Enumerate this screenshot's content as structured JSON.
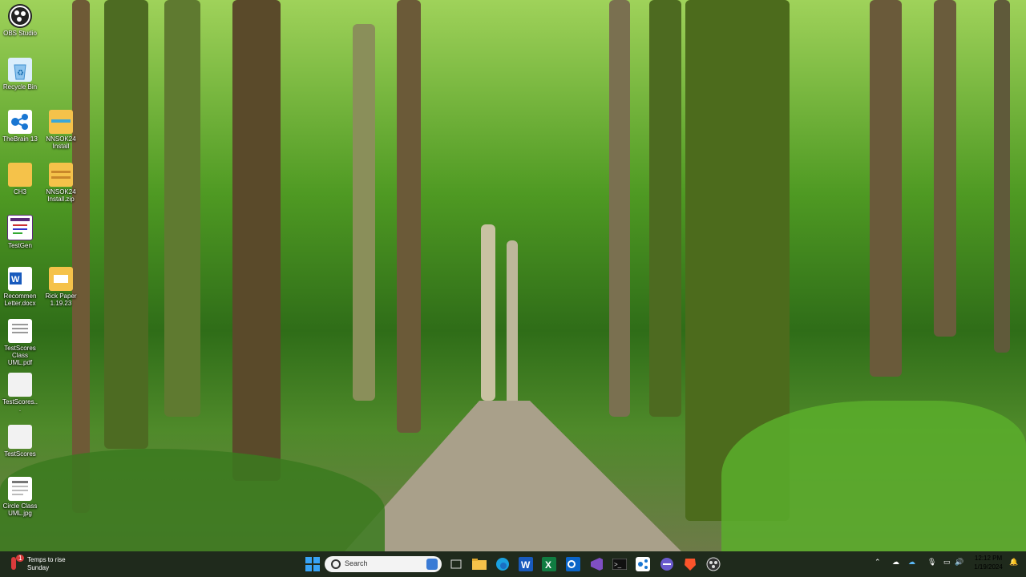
{
  "desktop_icons": [
    {
      "label": "OBS Studio"
    },
    {
      "label": "Recycle Bin"
    },
    {
      "label": "TheBrain 13"
    },
    {
      "label": "NNSOK24 Install"
    },
    {
      "label": "CH3"
    },
    {
      "label": "NNSOK24 Install.zip"
    },
    {
      "label": "TestGen"
    },
    {
      "label": "Recommen Letter.docx"
    },
    {
      "label": "Rick Paper 1.19.23"
    },
    {
      "label": "TestScores Class UML.pdf"
    },
    {
      "label": "TestScores..."
    },
    {
      "label": "TestScores"
    },
    {
      "label": "Circle Class UML.jpg"
    }
  ],
  "taskbar": {
    "weather_line1": "Temps to rise",
    "weather_line2": "Sunday",
    "weather_badge": "1",
    "search_placeholder": "Search",
    "pinned_apps": [
      "start-icon",
      "file-explorer-icon",
      "edge-icon",
      "word-icon",
      "excel-icon",
      "outlook-icon",
      "visual-studio-icon",
      "terminal-icon",
      "thebrain-icon",
      "app-icon",
      "brave-icon",
      "obs-icon"
    ],
    "clock_time": "12:12 PM",
    "clock_date": "1/19/2024"
  },
  "colors": {
    "taskbar_bg": "#1f2a1c",
    "accent": "#0078d4"
  }
}
